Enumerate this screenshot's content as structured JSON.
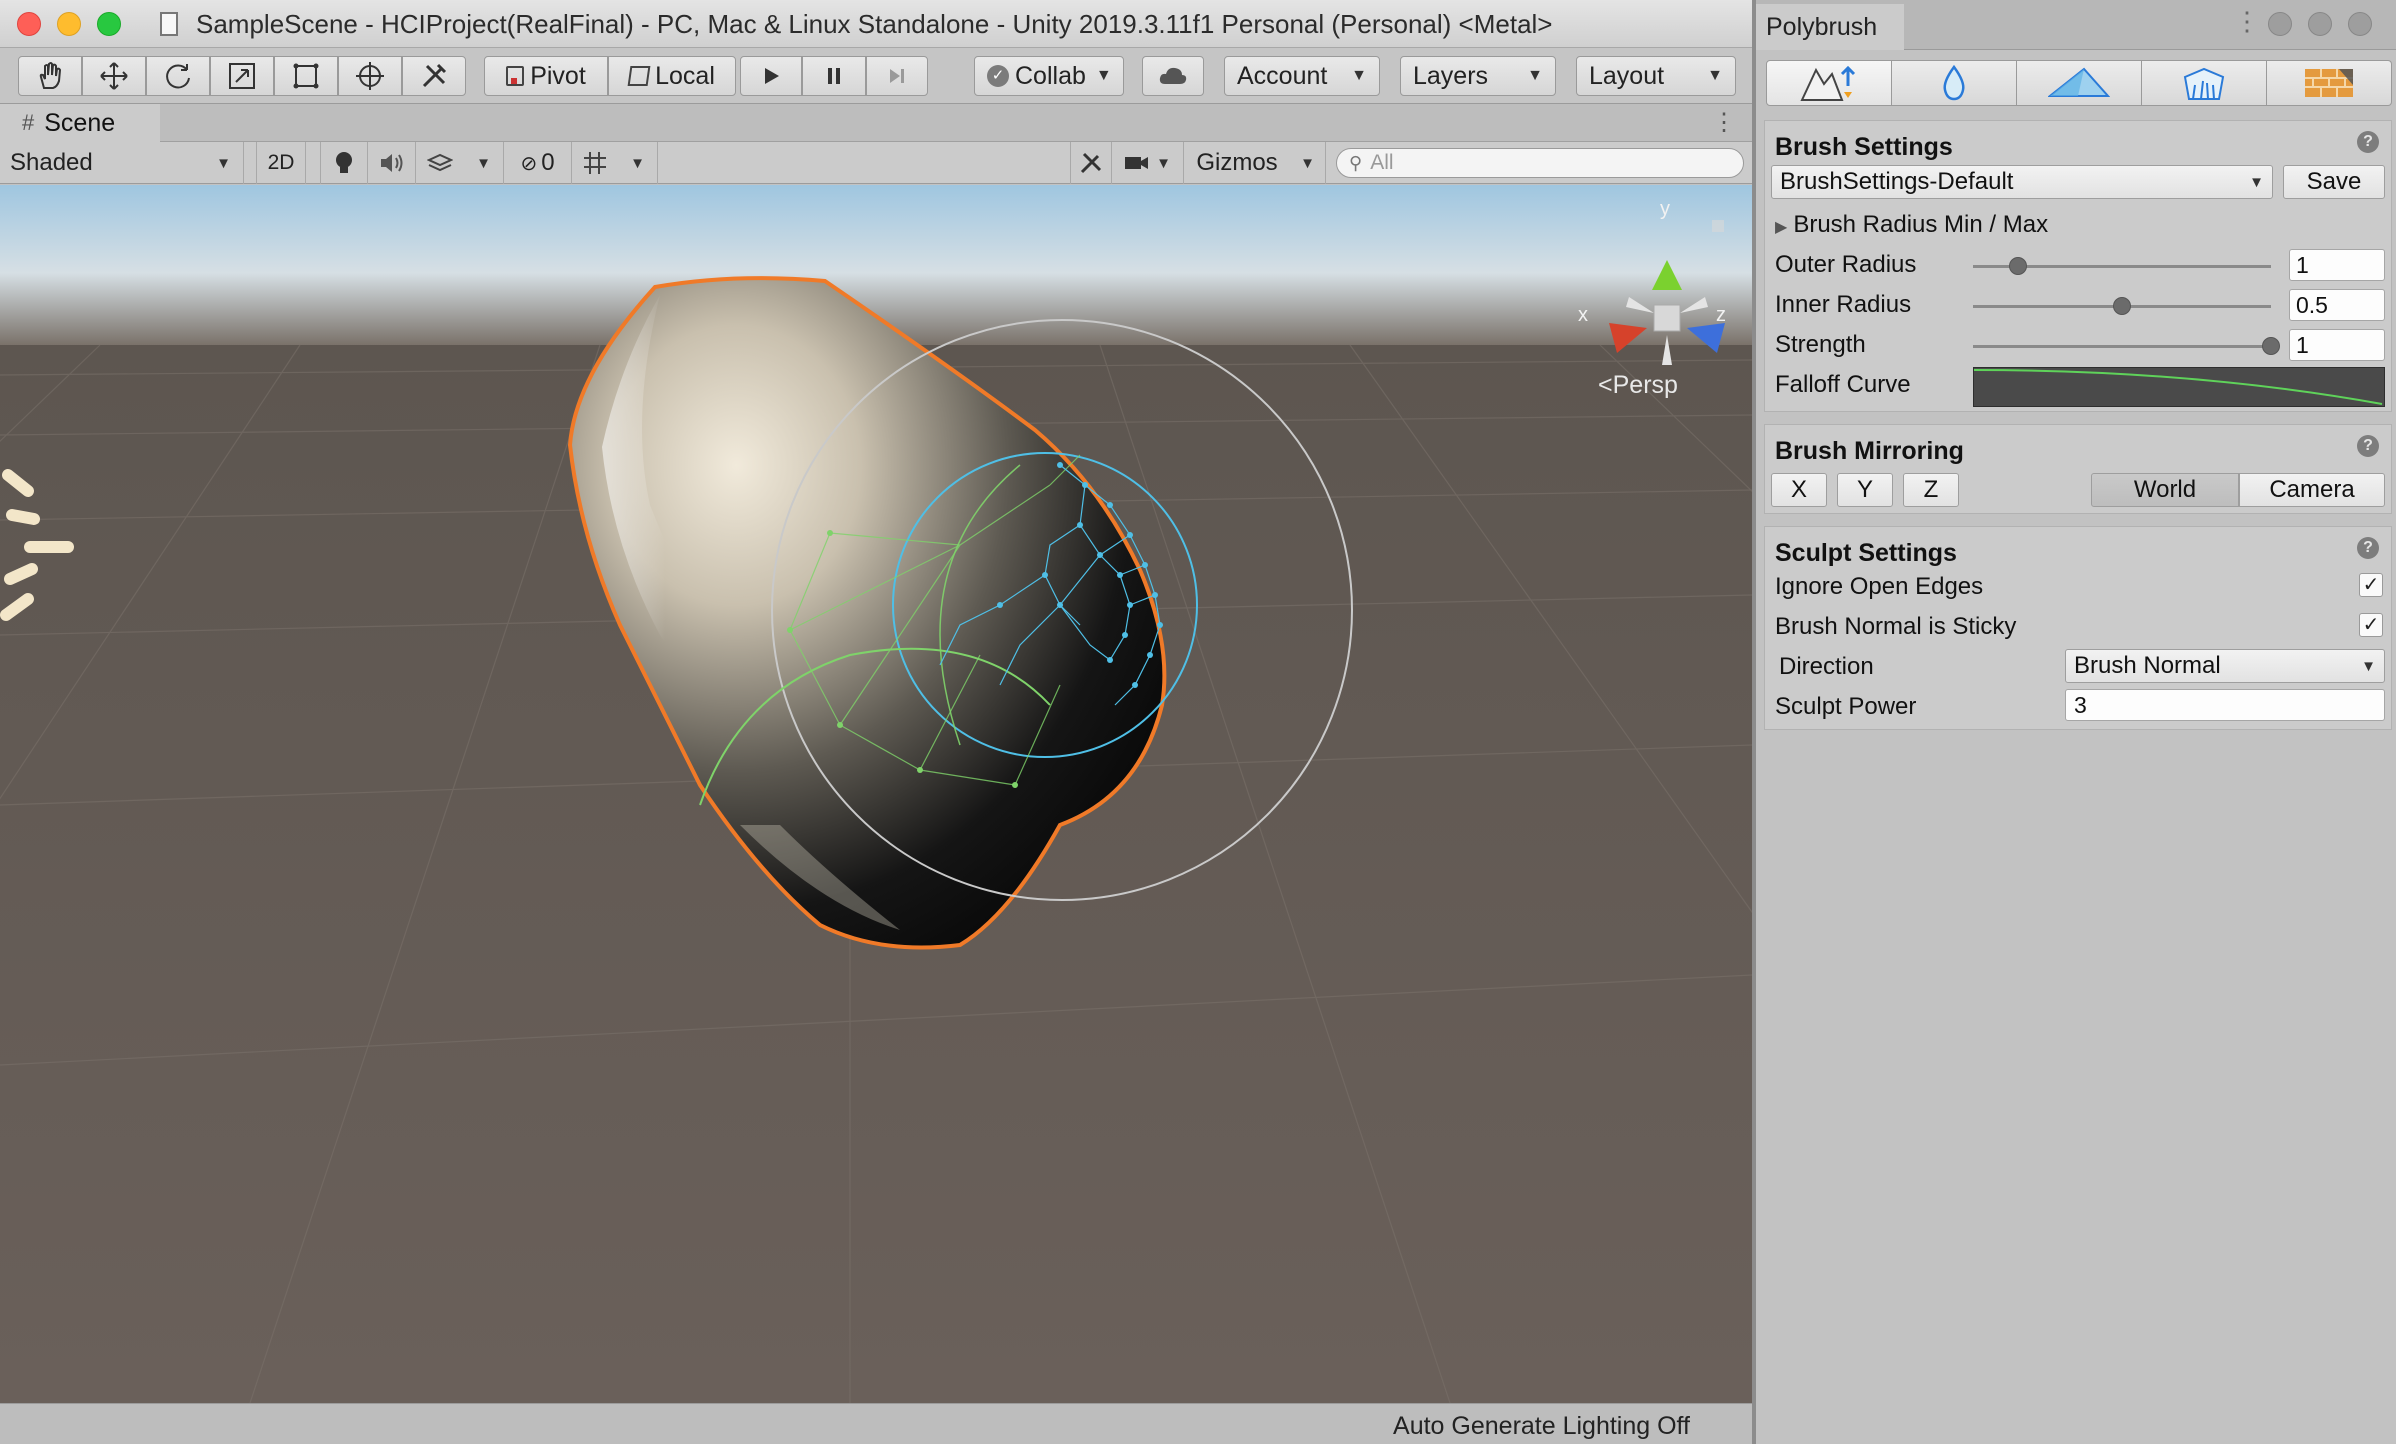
{
  "window": {
    "title": "SampleScene - HCIProject(RealFinal) - PC, Mac & Linux Standalone - Unity 2019.3.11f1 Personal (Personal) <Metal>"
  },
  "toolbar": {
    "tools": [
      {
        "icon": "hand-icon"
      },
      {
        "icon": "move-icon"
      },
      {
        "icon": "rotate-icon"
      },
      {
        "icon": "scale-icon"
      },
      {
        "icon": "rect-tool-icon"
      },
      {
        "icon": "transform-tool-icon"
      },
      {
        "icon": "custom-tool-icon"
      }
    ],
    "pivot_label": "Pivot",
    "local_label": "Local",
    "collab_label": "Collab",
    "account_label": "Account",
    "layers_label": "Layers",
    "layout_label": "Layout"
  },
  "scene": {
    "tab_label": "Scene",
    "shading_mode": "Shaded",
    "mode_2d_label": "2D",
    "hidden_count": "0",
    "gizmos_label": "Gizmos",
    "search_placeholder": "All",
    "projection_label": "Persp",
    "axis_labels": {
      "x": "x",
      "y": "y",
      "z": "z"
    },
    "status_text": "Auto Generate Lighting Off"
  },
  "polybrush": {
    "tab_label": "Polybrush",
    "modes": [
      {
        "name": "sculpt",
        "icon": "sculpt-mode-icon",
        "active": true
      },
      {
        "name": "smooth",
        "icon": "smooth-mode-icon",
        "active": false
      },
      {
        "name": "paint",
        "icon": "paint-mode-icon",
        "active": false
      },
      {
        "name": "prefab",
        "icon": "prefab-mode-icon",
        "active": false
      },
      {
        "name": "texture",
        "icon": "texture-mode-icon",
        "active": false
      }
    ],
    "brush_settings": {
      "title": "Brush Settings",
      "preset": "BrushSettings-Default",
      "save_label": "Save",
      "radius_foldout_label": "Brush Radius Min / Max",
      "outer_radius_label": "Outer Radius",
      "outer_radius_value": "1",
      "outer_radius_level": 0.15,
      "inner_radius_label": "Inner Radius",
      "inner_radius_value": "0.5",
      "inner_radius_level": 0.5,
      "strength_label": "Strength",
      "strength_value": "1",
      "strength_level": 1.0,
      "falloff_label": "Falloff Curve"
    },
    "brush_mirroring": {
      "title": "Brush Mirroring",
      "axis_x": "X",
      "axis_y": "Y",
      "axis_z": "Z",
      "space_world": "World",
      "space_camera": "Camera",
      "selected_space": "World"
    },
    "sculpt_settings": {
      "title": "Sculpt Settings",
      "ignore_open_edges_label": "Ignore Open Edges",
      "ignore_open_edges_checked": true,
      "brush_normal_sticky_label": "Brush Normal is Sticky",
      "brush_normal_sticky_checked": true,
      "direction_label": "Direction",
      "direction_value": "Brush Normal",
      "sculpt_power_label": "Sculpt Power",
      "sculpt_power_value": "3"
    }
  },
  "colors": {
    "selection_outline": "#f07a28",
    "gizmo_x": "#d6422b",
    "gizmo_y": "#7bd12f",
    "gizmo_z": "#3d6fdb",
    "brush_inner": "#4fbfe6",
    "brush_outer": "#c9c9c9",
    "brush_green": "#7fd36a",
    "sky_top": "#9fc6e0",
    "ground": "#6b6159"
  }
}
